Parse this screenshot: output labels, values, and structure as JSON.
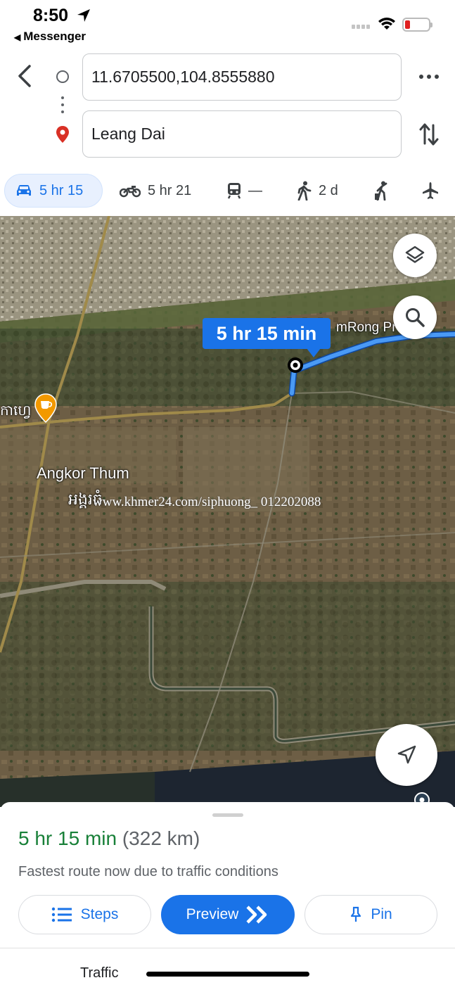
{
  "status_bar": {
    "time": "8:50",
    "back_app": "Messenger",
    "battery_color": "#e02020"
  },
  "directions": {
    "origin_value": "11.6705500,104.8555880",
    "destination_value": "Leang Dai",
    "icons": [
      "back-arrow-icon",
      "origin-circle-icon",
      "destination-pin-icon",
      "more-vertical-icon",
      "swap-icon"
    ]
  },
  "travel_modes": [
    {
      "mode": "drive",
      "icon": "car-icon",
      "label": "5 hr 15",
      "selected": true
    },
    {
      "mode": "motorcycle",
      "icon": "motorcycle-icon",
      "label": "5 hr 21"
    },
    {
      "mode": "transit",
      "icon": "train-icon",
      "label": "—"
    },
    {
      "mode": "walk",
      "icon": "walking-icon",
      "label": "2 d"
    },
    {
      "mode": "ride",
      "icon": "ride-hail-icon",
      "label": ""
    },
    {
      "mode": "flight",
      "icon": "airplane-icon",
      "label": ""
    }
  ],
  "map": {
    "duration_bubble": "5 hr 15 min",
    "place_label": "Angkor Thum",
    "place_label_khmer": "អង្គរធំ",
    "partial_label_left": "កាហ្វេ",
    "partial_label_school": "mRong Pr",
    "watermark": "www.khmer24.com/siphuong_ 012202088",
    "route_color": "#1a73e8"
  },
  "sheet": {
    "duration": "5 hr 15 min",
    "distance": "(322 km)",
    "subtext": "Fastest route now due to traffic conditions",
    "steps_label": "Steps",
    "preview_label": "Preview",
    "pin_label": "Pin",
    "tab_label": "Traffic",
    "duration_color": "#188038"
  }
}
